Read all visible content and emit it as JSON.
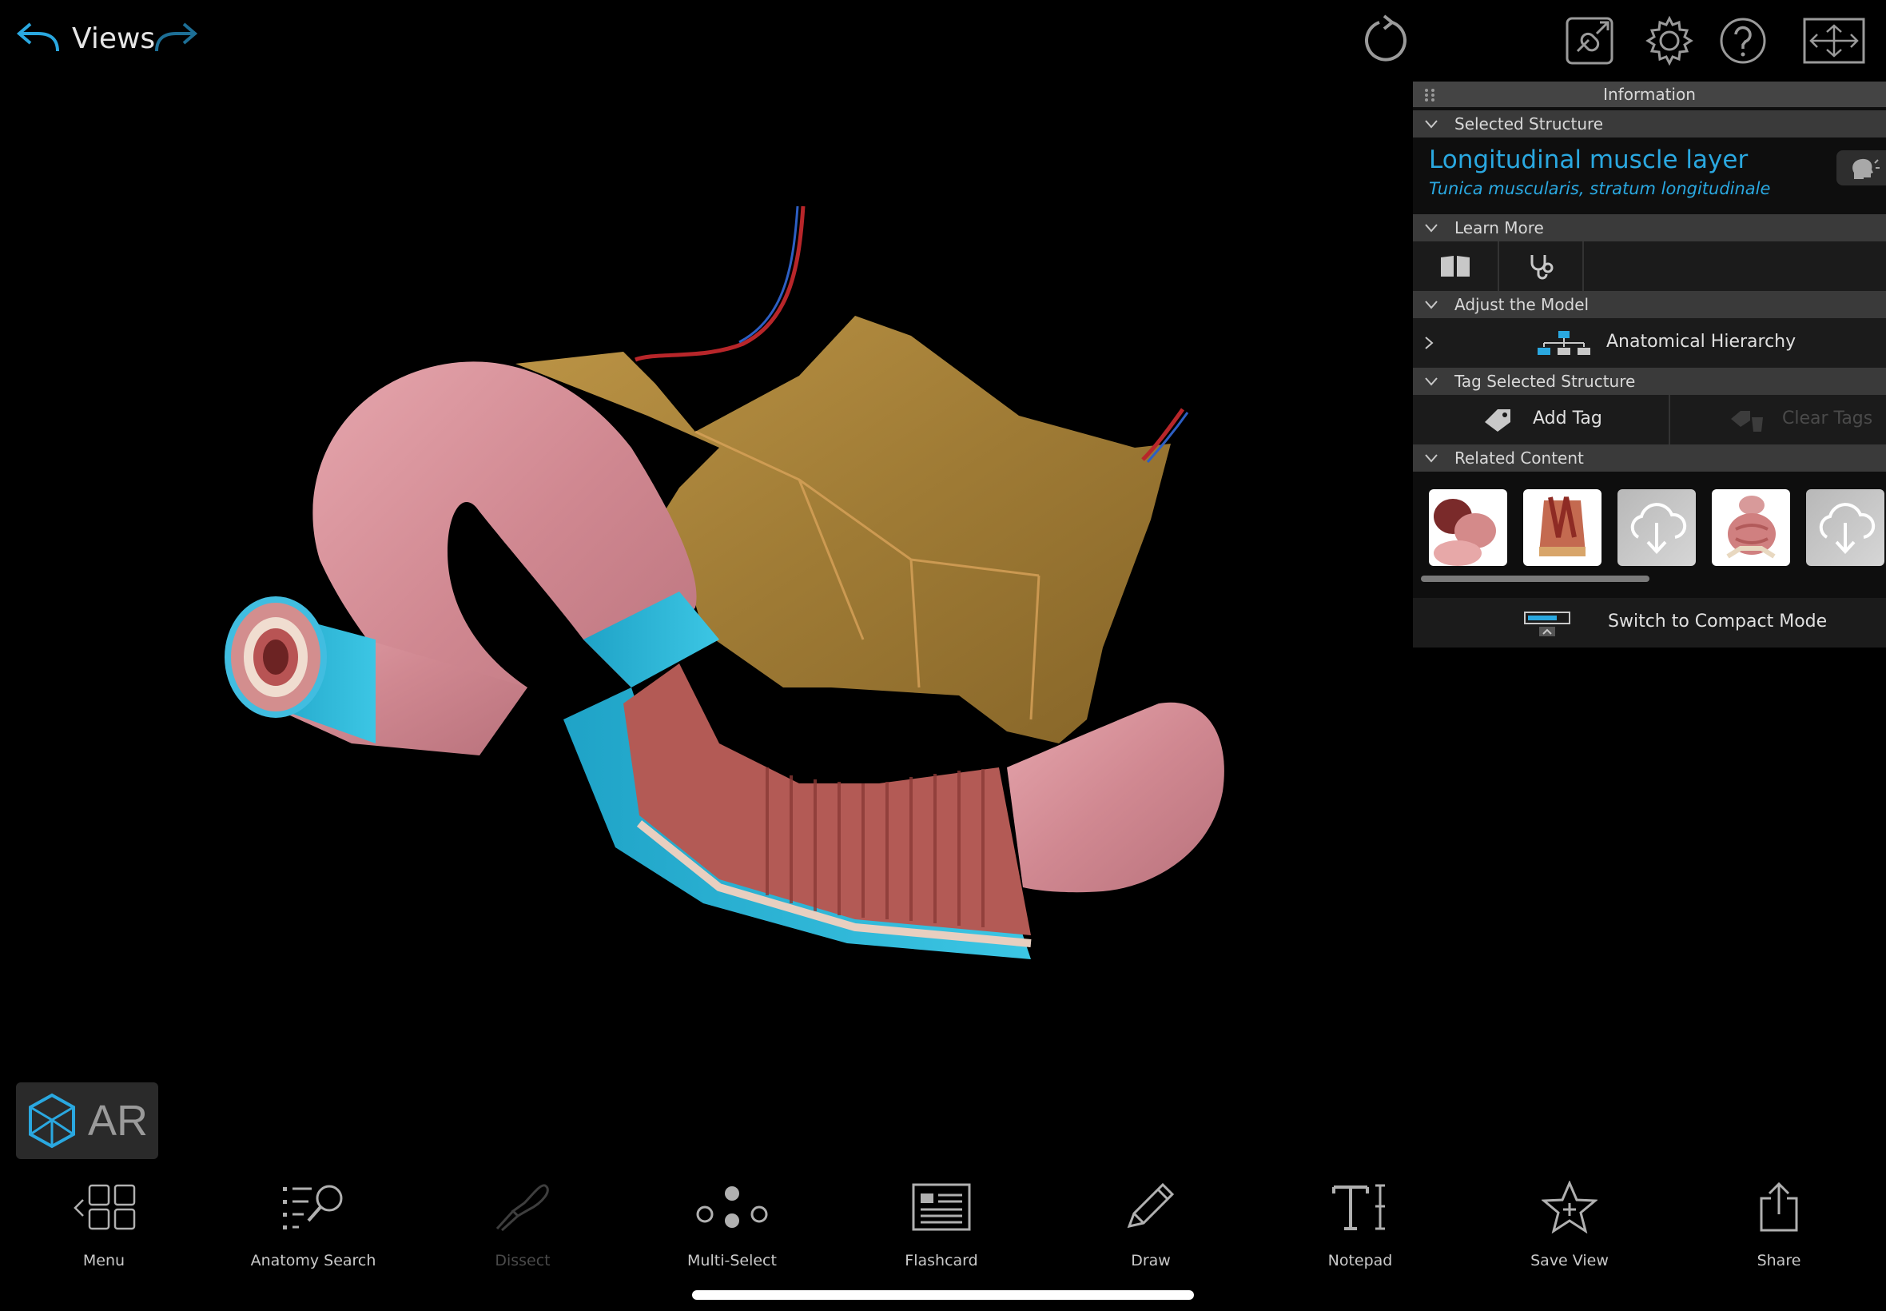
{
  "header": {
    "title": "Views"
  },
  "info_panel": {
    "title": "Information",
    "sections": {
      "selected_structure": "Selected Structure",
      "learn_more": "Learn More",
      "adjust_model": "Adjust the Model",
      "tag_structure": "Tag Selected Structure",
      "related_content": "Related Content"
    },
    "structure": {
      "name": "Longitudinal muscle layer",
      "latin": "Tunica muscularis, stratum longitudinale"
    },
    "hierarchy_label": "Anatomical Hierarchy",
    "add_tag": "Add Tag",
    "clear_tags": "Clear Tags",
    "compact_mode": "Switch to Compact Mode"
  },
  "ar": {
    "label": "AR"
  },
  "toolbar": {
    "menu": "Menu",
    "anatomy_search": "Anatomy Search",
    "dissect": "Dissect",
    "multi_select": "Multi-Select",
    "flashcard": "Flashcard",
    "draw": "Draw",
    "notepad": "Notepad",
    "save_view": "Save View",
    "share": "Share"
  },
  "colors": {
    "accent": "#2aa8e0",
    "panel_bar": "#3a3a3a",
    "muscle_cyan": "#29b6d6",
    "intestine_pink": "#d88e95",
    "mesentery": "#b48a3e"
  },
  "icons": {
    "undo": "undo-arrow-icon",
    "redo": "redo-arrow-icon",
    "reset": "rotate-reset-icon",
    "link": "link-icon",
    "settings": "gear-icon",
    "help": "question-icon",
    "fullscreen": "expand-icon"
  }
}
